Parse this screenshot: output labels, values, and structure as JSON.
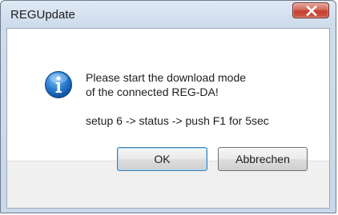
{
  "window": {
    "title": "REGUpdate"
  },
  "dialog": {
    "icon": "info-icon",
    "message_line1": "Please start the download mode",
    "message_line2": "of the connected REG-DA!",
    "message_line3": "setup 6 -> status -> push F1 for 5sec"
  },
  "buttons": {
    "ok_label": "OK",
    "cancel_label": "Abbrechen"
  },
  "colors": {
    "close_button": "#c2402f",
    "info_icon": "#1f6fc5",
    "default_button_border": "#3c7fb1"
  }
}
